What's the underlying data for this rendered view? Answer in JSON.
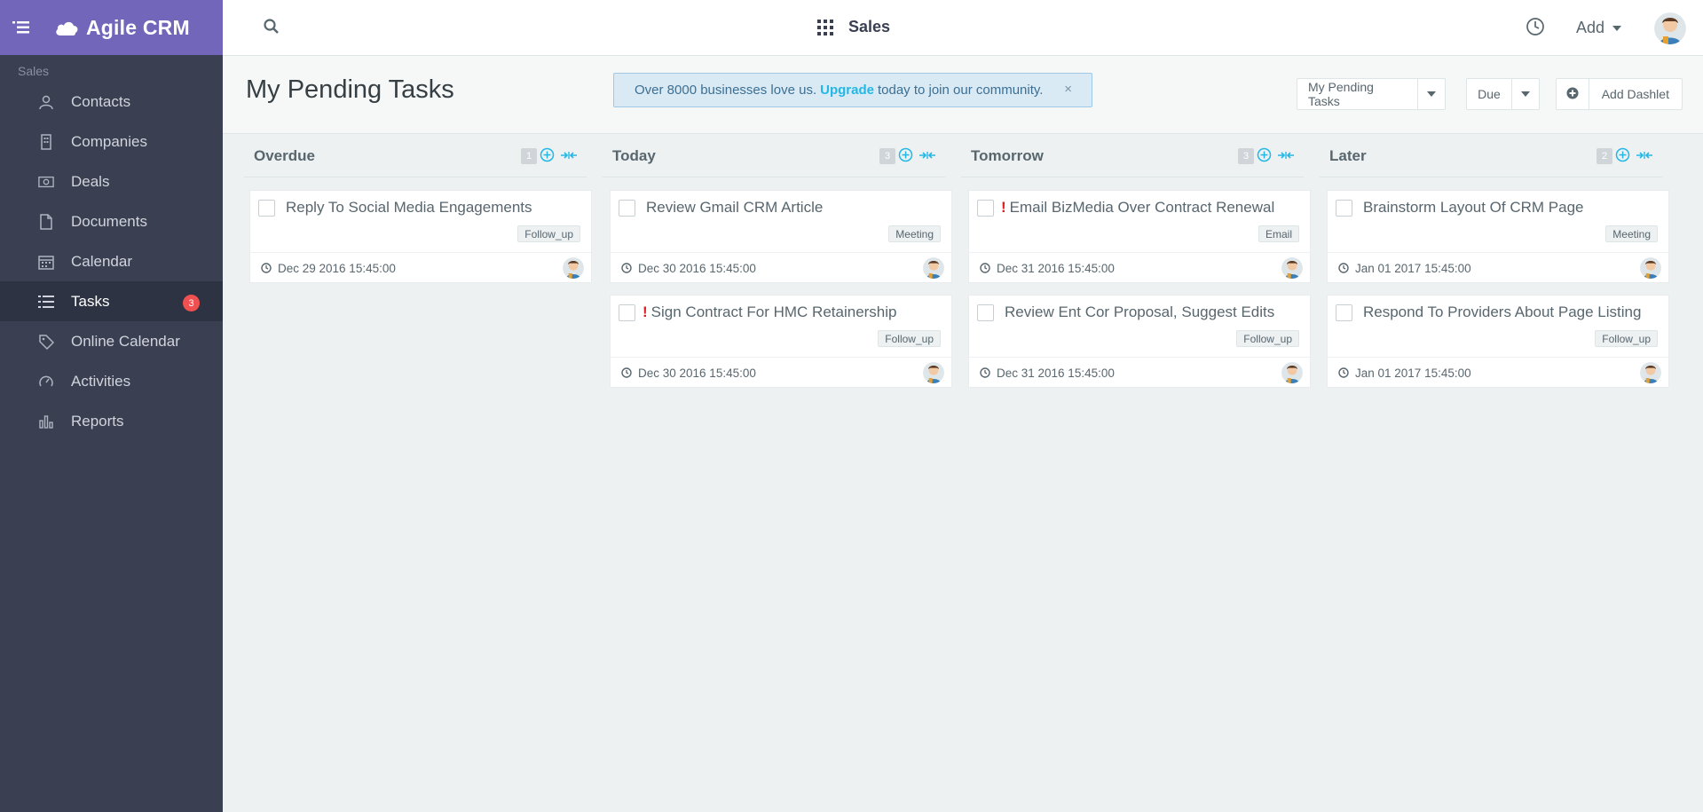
{
  "app": {
    "brand": "Agile CRM"
  },
  "sidebar": {
    "section_label": "Sales",
    "items": [
      {
        "label": "Contacts",
        "icon": "user-icon"
      },
      {
        "label": "Companies",
        "icon": "building-icon"
      },
      {
        "label": "Deals",
        "icon": "money-icon"
      },
      {
        "label": "Documents",
        "icon": "document-icon"
      },
      {
        "label": "Calendar",
        "icon": "calendar-icon"
      },
      {
        "label": "Tasks",
        "icon": "list-icon",
        "badge": "3",
        "active": true
      },
      {
        "label": "Online Calendar",
        "icon": "tag-icon"
      },
      {
        "label": "Activities",
        "icon": "gauge-icon"
      },
      {
        "label": "Reports",
        "icon": "bar-chart-icon"
      }
    ]
  },
  "topbar": {
    "module": "Sales",
    "add_label": "Add"
  },
  "header": {
    "title": "My Pending Tasks",
    "promo": {
      "before": "Over 8000 businesses love us.",
      "link": "Upgrade",
      "after": "today to join our community.",
      "close": "×"
    },
    "filter_label": "My Pending Tasks",
    "sort_label": "Due",
    "add_dashlet_label": "Add Dashlet"
  },
  "columns": [
    {
      "title": "Overdue",
      "count": "1",
      "tasks": [
        {
          "title": "Reply To Social Media Engagements",
          "priority": "",
          "tag": "Follow_up",
          "due": "Dec 29 2016 15:45:00"
        }
      ]
    },
    {
      "title": "Today",
      "count": "3",
      "tasks": [
        {
          "title": "Review Gmail CRM Article",
          "priority": "",
          "tag": "Meeting",
          "due": "Dec 30 2016 15:45:00"
        },
        {
          "title": "Sign Contract For HMC Retainership",
          "priority": "!",
          "tag": "Follow_up",
          "due": "Dec 30 2016 15:45:00"
        }
      ]
    },
    {
      "title": "Tomorrow",
      "count": "3",
      "tasks": [
        {
          "title": "Email BizMedia Over Contract Renewal",
          "priority": "!",
          "tag": "Email",
          "due": "Dec 31 2016 15:45:00"
        },
        {
          "title": "Review Ent Cor Proposal, Suggest Edits",
          "priority": "",
          "tag": "Follow_up",
          "due": "Dec 31 2016 15:45:00"
        }
      ]
    },
    {
      "title": "Later",
      "count": "2",
      "tasks": [
        {
          "title": "Brainstorm Layout Of CRM Page",
          "priority": "",
          "tag": "Meeting",
          "due": "Jan 01 2017 15:45:00"
        },
        {
          "title": "Respond To Providers About Page Listing",
          "priority": "",
          "tag": "Follow_up",
          "due": "Jan 01 2017 15:45:00"
        }
      ]
    }
  ],
  "colors": {
    "brand": "#7266ba",
    "sidebar": "#3a3f51",
    "accent": "#23b7e5",
    "danger": "#f05050"
  }
}
